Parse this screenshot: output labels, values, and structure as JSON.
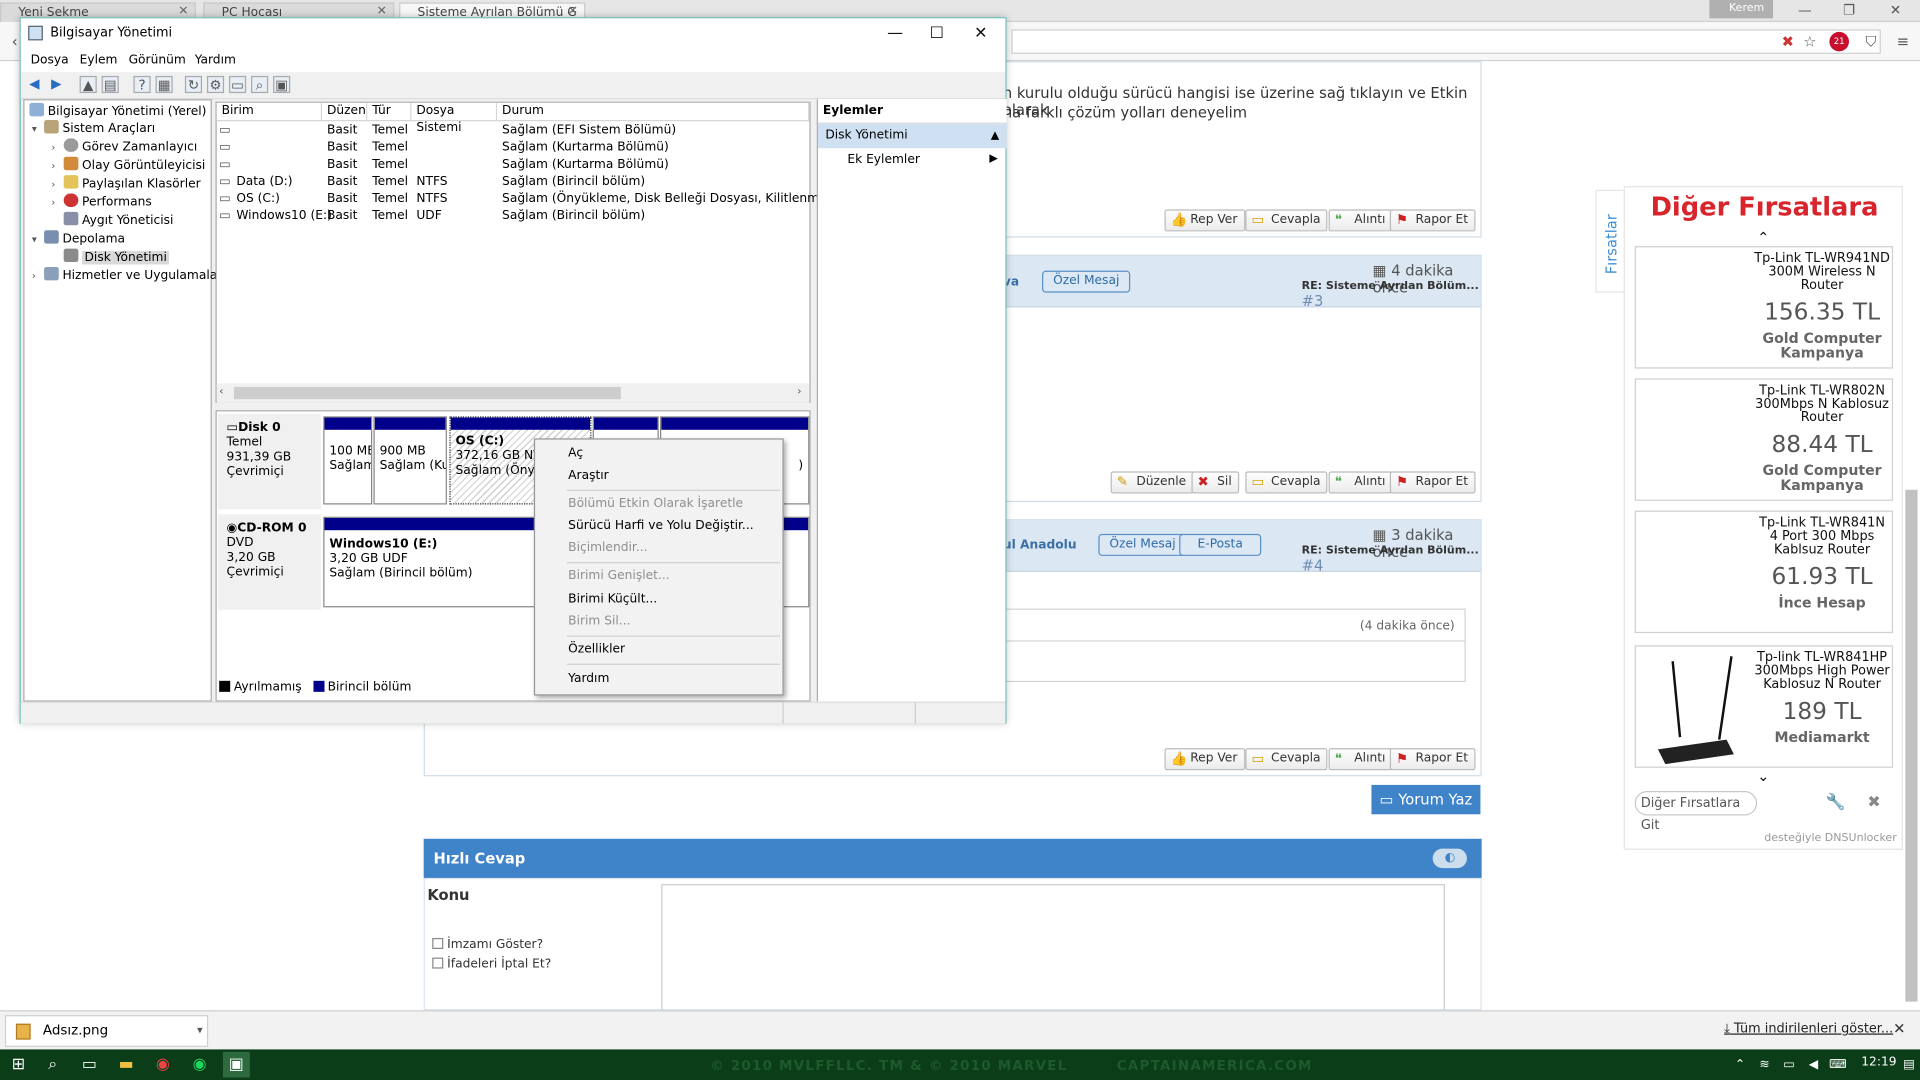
{
  "browser": {
    "tabs": [
      "Yeni Sekme",
      "PC Hocası",
      "Sisteme Ayrılan Bölümü G"
    ],
    "profile": "Kerem",
    "adblock_badge": "21"
  },
  "page": {
    "post1_text_line1": "n kurulu olduğu sürücü hangisi ise üzerine sağ tıklayın ve Etkin olarak",
    "post1_text_line2": "na farklı çözüm yolları deneyelim",
    "btn_rep": "Rep Ver",
    "btn_reply": "Cevapla",
    "btn_quote": "Alıntı",
    "btn_report": "Rapor Et",
    "btn_edit": "Düzenle",
    "btn_delete": "Sil",
    "post2_author_tail": "va",
    "post2_pm": "Özel Mesaj",
    "post2_ago": "4 dakika önce",
    "post2_re": "RE: Sisteme Ayrılan Bölüm...",
    "post2_num": "#3",
    "post3_author_tail": "ul Anadolu",
    "post3_pm": "Özel Mesaj",
    "post3_email": "E-Posta",
    "post3_ago": "3 dakika önce",
    "post3_re": "RE: Sisteme Ayrılan Bölüm...",
    "post3_num": "#4",
    "post3_quote_ago": "(4 dakika önce)",
    "btn_comment": "Yorum Yaz",
    "quick_reply_title": "Hızlı Cevap",
    "subject_label": "Konu",
    "chk_signature": "İmzamı Göster?",
    "chk_smilies": "İfadeleri İptal Et?",
    "footer_watermark": "© 2010 MVLFFLLC. TM & © 2010 MARVEL",
    "footer_watermark2": "CAPTAINAMERICA.COM"
  },
  "ad": {
    "side_tab": "Fırsatlar",
    "title": "Diğer Fırsatlara",
    "deals": [
      {
        "name": "Tp-Link TL-WR941ND 300M Wireless N Router",
        "price": "156.35 TL",
        "store": "Gold Computer Kampanya"
      },
      {
        "name": "Tp-Link TL-WR802N 300Mbps N Kablosuz Router",
        "price": "88.44 TL",
        "store": "Gold Computer Kampanya"
      },
      {
        "name": "Tp-Link TL-WR841N 4 Port 300 Mbps Kablsuz Router",
        "price": "61.93 TL",
        "store": "İnce Hesap"
      },
      {
        "name": "Tp-link TL-WR841HP 300Mbps High Power Kablosuz N Router",
        "price": "189 TL",
        "store": "Mediamarkt"
      }
    ],
    "search_placeholder": "Diğer Fırsatlara Git",
    "footer": "desteğiyle DNSUnlocker"
  },
  "window": {
    "title": "Bilgisayar Yönetimi",
    "menu": [
      "Dosya",
      "Eylem",
      "Görünüm",
      "Yardım"
    ],
    "tree": [
      {
        "label": "Bilgisayar Yönetimi (Yerel)",
        "level": 0,
        "exp": ""
      },
      {
        "label": "Sistem Araçları",
        "level": 1,
        "exp": "▾"
      },
      {
        "label": "Görev Zamanlayıcı",
        "level": 2,
        "exp": "›"
      },
      {
        "label": "Olay Görüntüleyicisi",
        "level": 2,
        "exp": "›"
      },
      {
        "label": "Paylaşılan Klasörler",
        "level": 2,
        "exp": "›"
      },
      {
        "label": "Performans",
        "level": 2,
        "exp": "›"
      },
      {
        "label": "Aygıt Yöneticisi",
        "level": 2,
        "exp": ""
      },
      {
        "label": "Depolama",
        "level": 1,
        "exp": "▾"
      },
      {
        "label": "Disk Yönetimi",
        "level": 2,
        "exp": ""
      },
      {
        "label": "Hizmetler ve Uygulamalar",
        "level": 1,
        "exp": "›"
      }
    ],
    "columns": [
      "Birim",
      "Düzen",
      "Tür",
      "Dosya Sistemi",
      "Durum"
    ],
    "volumes": [
      [
        "",
        "Basit",
        "Temel",
        "",
        "Sağlam (EFI Sistem Bölümü)"
      ],
      [
        "",
        "Basit",
        "Temel",
        "",
        "Sağlam (Kurtarma Bölümü)"
      ],
      [
        "",
        "Basit",
        "Temel",
        "",
        "Sağlam (Kurtarma Bölümü)"
      ],
      [
        "Data (D:)",
        "Basit",
        "Temel",
        "NTFS",
        "Sağlam (Birincil bölüm)"
      ],
      [
        "OS (C:)",
        "Basit",
        "Temel",
        "NTFS",
        "Sağlam (Önyükleme, Disk Belleği Dosyası, Kilitlenme Bilgisi"
      ],
      [
        "Windows10 (E:)",
        "Basit",
        "Temel",
        "UDF",
        "Sağlam (Birincil bölüm)"
      ]
    ],
    "disk0": {
      "name": "Disk 0",
      "type": "Temel",
      "size": "931,39 GB",
      "state": "Çevrimiçi"
    },
    "disk0_parts": [
      {
        "l1": "100 MB",
        "l2": "Sağlam"
      },
      {
        "l1": "900 MB",
        "l2": "Sağlam (Ku"
      },
      {
        "l1": "OS  (C:)",
        "l2": "372,16 GB NTFS",
        "l3": "Sağlam (Önyü"
      },
      {
        "l1": "",
        "l2": ""
      },
      {
        "l1": "",
        "l2": ")"
      }
    ],
    "cdrom": {
      "name": "CD-ROM 0",
      "type": "DVD",
      "size": "3,20 GB",
      "state": "Çevrimiçi"
    },
    "cd_part": {
      "l1": "Windows10  (E:)",
      "l2": "3,20 GB UDF",
      "l3": "Sağlam (Birincil bölüm)"
    },
    "legend_unallocated": "Ayrılmamış",
    "legend_primary": "Birincil bölüm",
    "actions_header": "Eylemler",
    "actions_selected": "Disk Yönetimi",
    "actions_more": "Ek Eylemler"
  },
  "context_menu": {
    "open": "Aç",
    "explore": "Araştır",
    "mark_active": "Bölümü Etkin Olarak İşaretle",
    "change_letter": "Sürücü Harfi ve Yolu Değiştir...",
    "format": "Biçimlendir...",
    "extend": "Birimi Genişlet...",
    "shrink": "Birimi Küçült...",
    "delete": "Birim Sil...",
    "properties": "Özellikler",
    "help": "Yardım"
  },
  "download": {
    "file": "Adsız.png",
    "show_all": "Tüm indirilenleri göster..."
  },
  "taskbar": {
    "time": "12:19"
  }
}
